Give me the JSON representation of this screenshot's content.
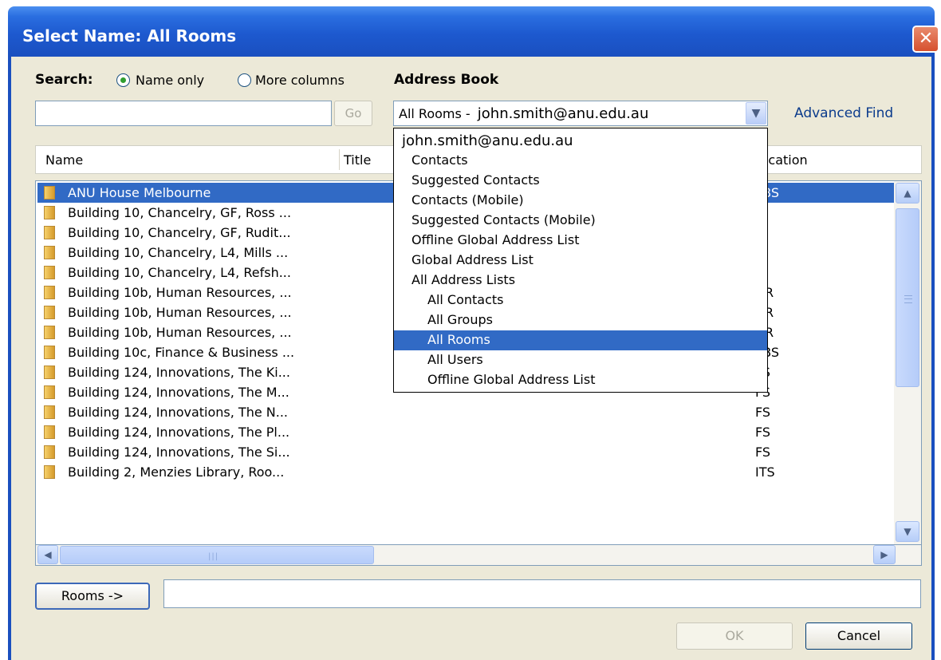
{
  "window": {
    "title": "Select Name: All Rooms",
    "close_glyph": "✕"
  },
  "search": {
    "label": "Search:",
    "radio_name_only": "Name only",
    "radio_more_columns": "More columns",
    "go_label": "Go",
    "value": ""
  },
  "address_book": {
    "label": "Address Book",
    "combo_prefix": "All Rooms -",
    "combo_account": "john.smith@anu.edu.au",
    "advanced_find": "Advanced Find",
    "dropdown": {
      "account": "john.smith@anu.edu.au",
      "items": [
        "Contacts",
        "Suggested Contacts",
        "Contacts (Mobile)",
        "Suggested Contacts (Mobile)",
        "Offline Global Address List",
        "Global Address List",
        "All Address Lists"
      ],
      "sub_items": [
        "All Contacts",
        "All Groups",
        "All Rooms",
        "All Users",
        "Offline Global Address List"
      ],
      "selected": "All Rooms"
    }
  },
  "columns": {
    "name": "Name",
    "title": "Title",
    "location": "Location"
  },
  "rows": [
    {
      "name": "ANU House Melbourne",
      "location": "FBS"
    },
    {
      "name": "Building 10, Chancelry, GF, Ross ...",
      "location": ""
    },
    {
      "name": "Building 10, Chancelry, GF, Rudit...",
      "location": ""
    },
    {
      "name": "Building 10, Chancelry, L4, Mills ...",
      "location": ""
    },
    {
      "name": "Building 10, Chancelry, L4, Refsh...",
      "location": ""
    },
    {
      "name": "Building 10b, Human Resources, ...",
      "location": "HR"
    },
    {
      "name": "Building 10b, Human Resources, ...",
      "location": "HR"
    },
    {
      "name": "Building 10b, Human Resources, ...",
      "location": "HR"
    },
    {
      "name": "Building 10c, Finance & Business ...",
      "location": "FBS"
    },
    {
      "name": "Building 124, Innovations, The Ki...",
      "location": "FS"
    },
    {
      "name": "Building 124, Innovations, The M...",
      "location": "FS"
    },
    {
      "name": "Building 124, Innovations, The N...",
      "location": "FS"
    },
    {
      "name": "Building 124, Innovations, The Pl...",
      "location": "FS"
    },
    {
      "name": "Building 124, Innovations, The Si...",
      "location": "FS"
    },
    {
      "name": "Building 2, Menzies Library, Roo...",
      "location": "ITS"
    }
  ],
  "footer": {
    "rooms_button": "Rooms ->",
    "rooms_value": "",
    "ok": "OK",
    "cancel": "Cancel"
  },
  "icons": {
    "scroll_up": "▲",
    "scroll_down": "▼",
    "scroll_left": "◀",
    "scroll_right": "▶",
    "combo_arrow": "▼"
  }
}
